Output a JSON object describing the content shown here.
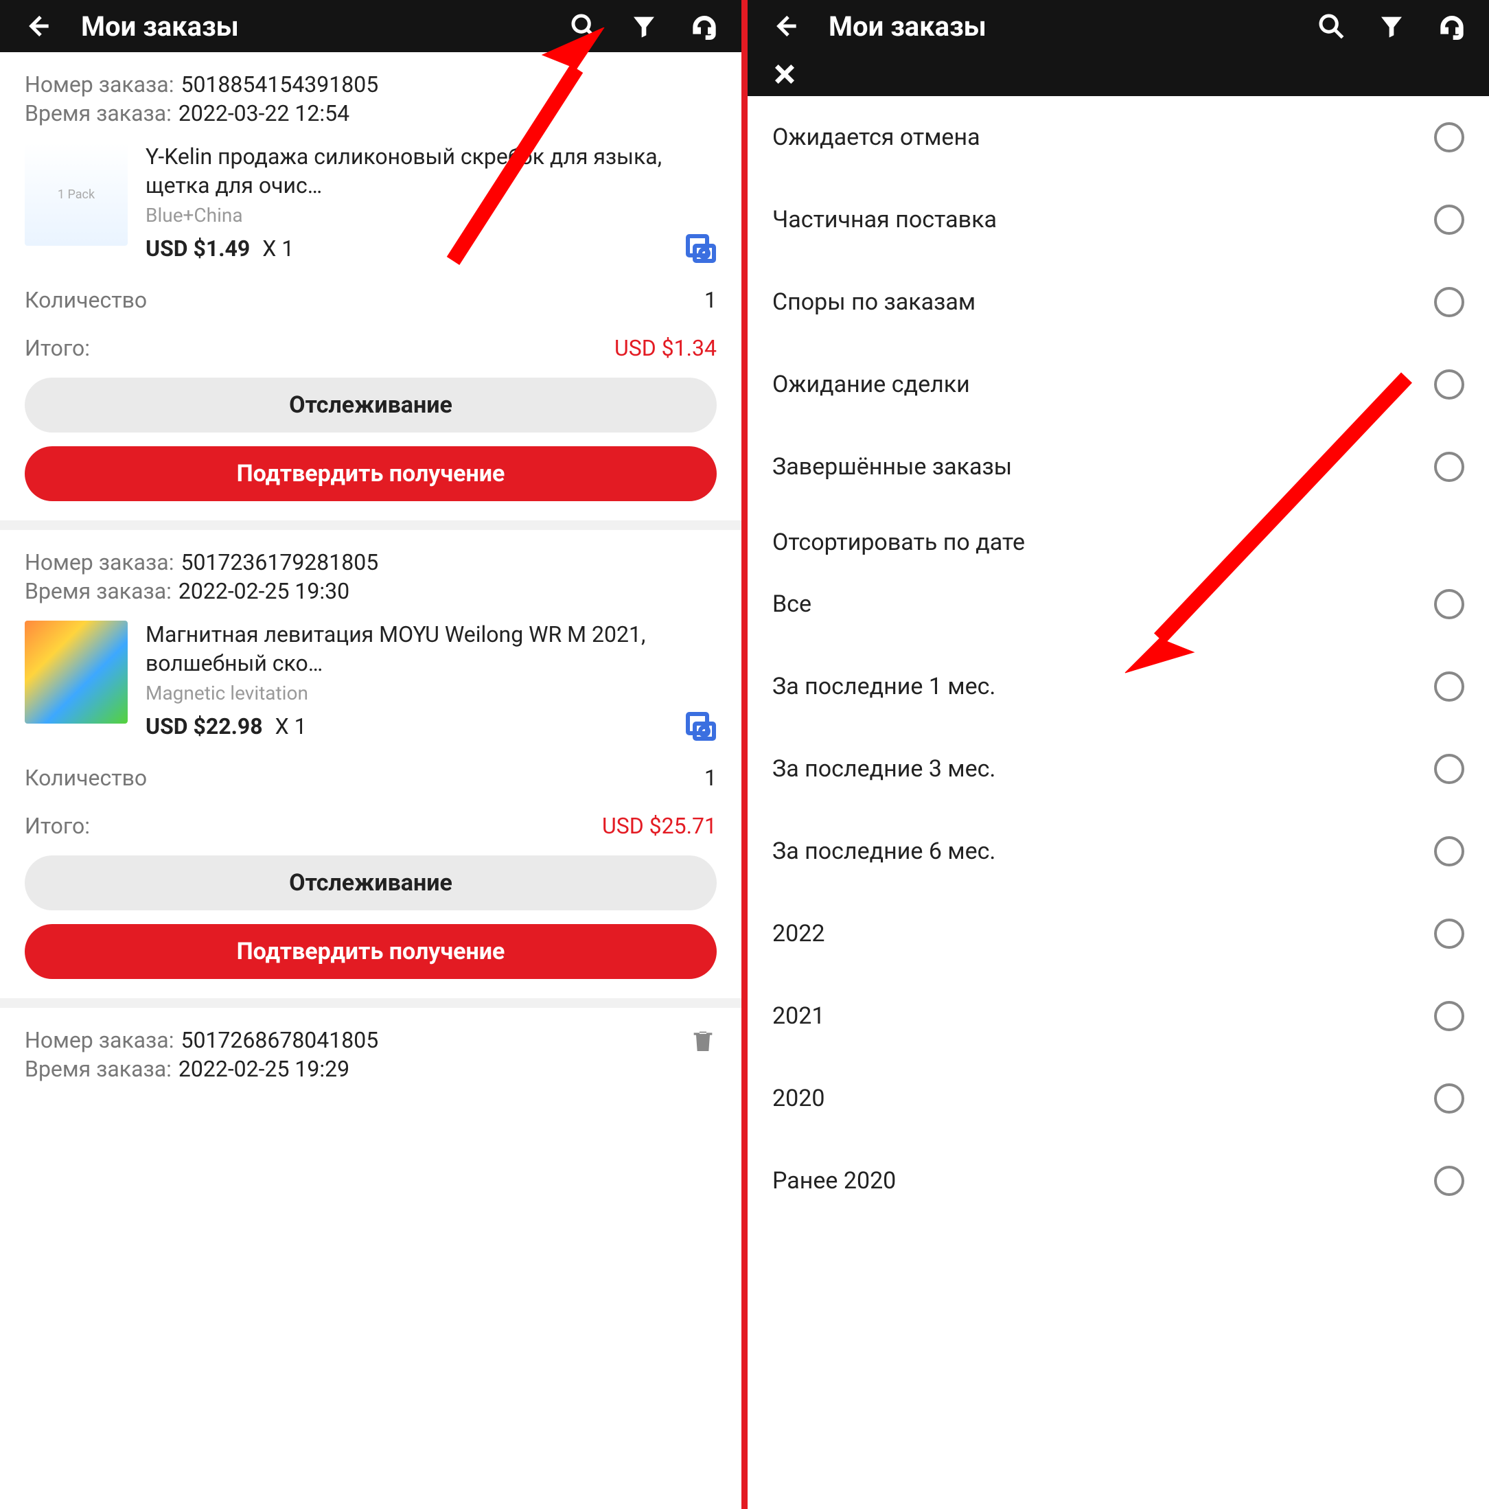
{
  "left": {
    "header": {
      "title": "Мои заказы"
    },
    "orders": [
      {
        "number_label": "Номер заказа:",
        "number": "5018854154391805",
        "time_label": "Время заказа:",
        "time": "2022-03-22 12:54",
        "title": "Y-Kelin продажа силиконовый скребок для языка, щетка для очис…",
        "variant": "Blue+China",
        "price": "USD $1.49",
        "qty": "X 1",
        "qty_label": "Количество",
        "qty_val": "1",
        "total_label": "Итого:",
        "total": "USD $1.34",
        "btn_track": "Отслеживание",
        "btn_confirm": "Подтвердить получение"
      },
      {
        "number_label": "Номер заказа:",
        "number": "5017236179281805",
        "time_label": "Время заказа:",
        "time": "2022-02-25 19:30",
        "title": "Магнитная левитация MOYU Weilong WR M 2021, волшебный ско…",
        "variant": "Magnetic levitation",
        "price": "USD $22.98",
        "qty": "X 1",
        "qty_label": "Количество",
        "qty_val": "1",
        "total_label": "Итого:",
        "total": "USD $25.71",
        "btn_track": "Отслеживание",
        "btn_confirm": "Подтвердить получение"
      },
      {
        "number_label": "Номер заказа:",
        "number": "5017268678041805",
        "time_label": "Время заказа:",
        "time": "2022-02-25 19:29"
      }
    ]
  },
  "right": {
    "header": {
      "title": "Мои заказы"
    },
    "status_items": [
      "Ожидается отмена",
      "Частичная поставка",
      "Споры по заказам",
      "Ожидание сделки",
      "Завершённые заказы"
    ],
    "sort_title": "Отсортировать по дате",
    "date_items": [
      "Все",
      "За последние 1 мес.",
      "За последние 3 мес.",
      "За последние 6 мес.",
      "2022",
      "2021",
      "2020",
      "Ранее 2020"
    ]
  }
}
